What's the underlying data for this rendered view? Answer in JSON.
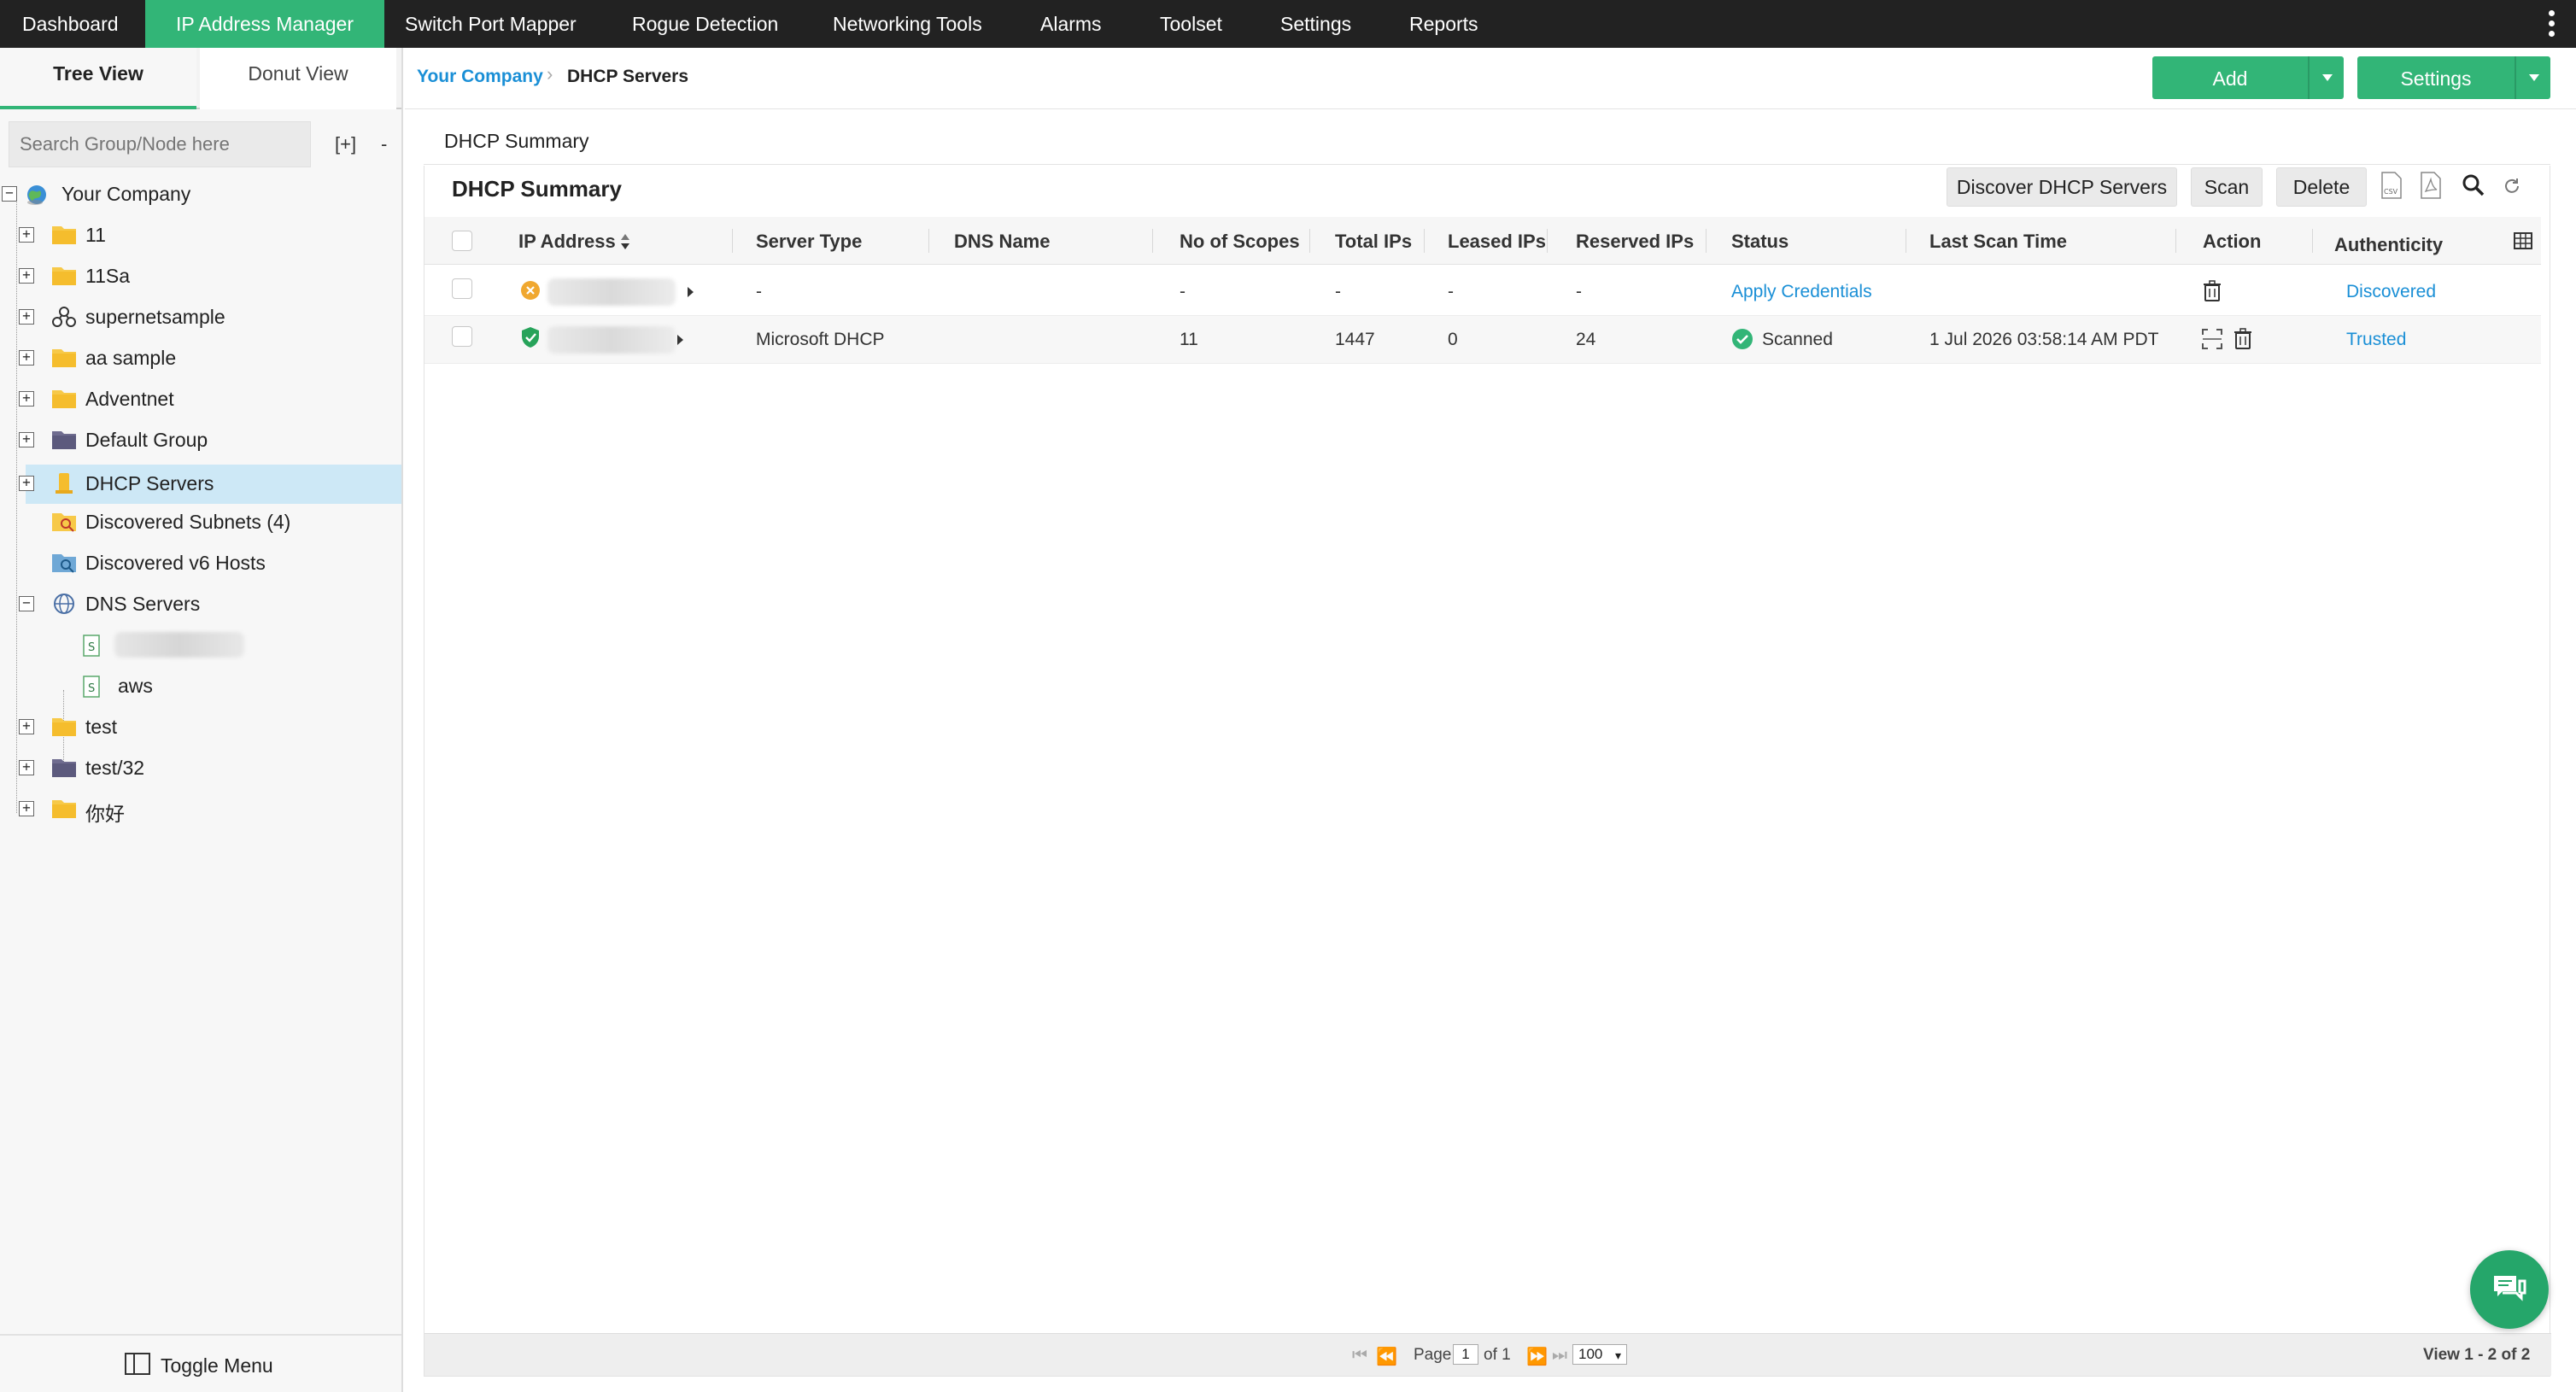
{
  "nav": {
    "items": [
      "Dashboard",
      "IP Address Manager",
      "Switch Port Mapper",
      "Rogue Detection",
      "Networking Tools",
      "Alarms",
      "Toolset",
      "Settings",
      "Reports"
    ],
    "active": "IP Address Manager",
    "accent": "#32b577"
  },
  "left": {
    "tabs": [
      "Tree View",
      "Donut View"
    ],
    "search_placeholder": "Search Group/Node here",
    "expand_all": "[+]",
    "collapse_all": "-",
    "tree": [
      {
        "label": "Your Company",
        "icon": "globe-icon"
      },
      {
        "label": "11",
        "icon": "folder-icon"
      },
      {
        "label": "11Sa",
        "icon": "folder-icon"
      },
      {
        "label": "supernetsample",
        "icon": "network-icon"
      },
      {
        "label": "aa sample",
        "icon": "folder-icon"
      },
      {
        "label": "Adventnet",
        "icon": "folder-icon"
      },
      {
        "label": "Default Group",
        "icon": "folder-dark-icon"
      },
      {
        "label": "DHCP Servers",
        "icon": "dhcp-server-icon"
      },
      {
        "label": "Discovered Subnets (4)",
        "icon": "discovered-subnets-icon"
      },
      {
        "label": "Discovered v6 Hosts",
        "icon": "v6-hosts-icon"
      },
      {
        "label": "DNS Servers",
        "icon": "dns-globe-icon"
      },
      {
        "label": "aws",
        "icon": "dns-zone-icon"
      },
      {
        "label": "test",
        "icon": "folder-icon"
      },
      {
        "label": "test/32",
        "icon": "folder-dark-icon"
      },
      {
        "label": "你好",
        "icon": "folder-icon"
      }
    ],
    "toggle_menu": "Toggle Menu"
  },
  "breadcrumb": {
    "root": "Your Company",
    "current": "DHCP Servers"
  },
  "header_buttons": {
    "add": "Add",
    "settings": "Settings"
  },
  "main": {
    "subtab": "DHCP Summary",
    "title": "DHCP Summary",
    "actions": {
      "discover": "Discover DHCP Servers",
      "scan": "Scan",
      "delete": "Delete"
    },
    "columns": [
      "IP Address",
      "Server Type",
      "DNS Name",
      "No of Scopes",
      "Total IPs",
      "Leased IPs",
      "Reserved IPs",
      "Status",
      "Last Scan Time",
      "Action",
      "Authenticity"
    ],
    "rows": [
      {
        "server_type": "-",
        "dns_name": "",
        "scopes": "-",
        "total_ips": "-",
        "leased_ips": "-",
        "reserved_ips": "-",
        "status": "Apply Credentials",
        "last_scan": "",
        "authenticity": "Discovered"
      },
      {
        "server_type": "Microsoft DHCP",
        "dns_name": "",
        "scopes": "11",
        "total_ips": "1447",
        "leased_ips": "0",
        "reserved_ips": "24",
        "status": "Scanned",
        "last_scan": "1 Jul 2026 03:58:14 AM PDT",
        "authenticity": "Trusted"
      }
    ]
  },
  "pager": {
    "page_label": "Page",
    "page": "1",
    "of_label": "of 1",
    "page_size": "100",
    "summary": "View 1 - 2 of 2"
  }
}
